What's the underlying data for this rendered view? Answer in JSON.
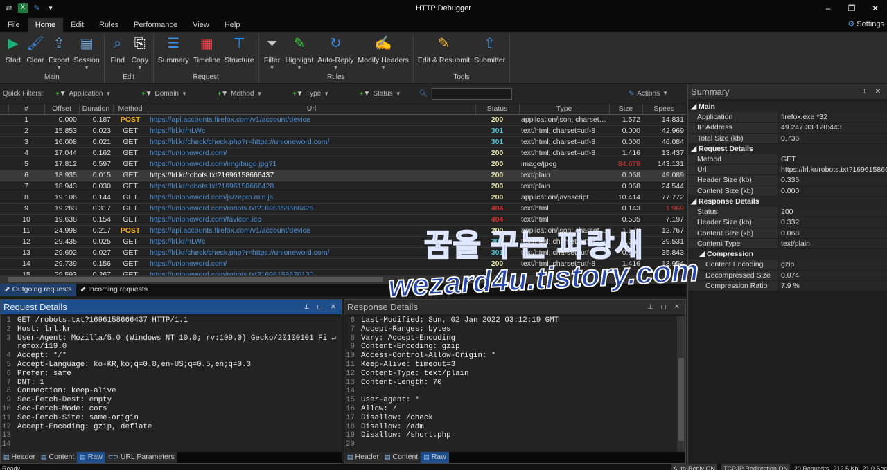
{
  "app": {
    "title": "HTTP Debugger",
    "settings": "Settings"
  },
  "menu_tabs": [
    "File",
    "Home",
    "Edit",
    "Rules",
    "Performance",
    "View",
    "Help"
  ],
  "ribbon": [
    {
      "group": "Main",
      "buttons": [
        {
          "label": "Start",
          "icon": "play-icon",
          "color": "#1db07a"
        },
        {
          "label": "Clear",
          "icon": "broom-icon",
          "color": "#3a8ee6"
        },
        {
          "label": "Export",
          "icon": "export-icon",
          "dropdown": true,
          "color": "#6fa8dc"
        },
        {
          "label": "Session",
          "icon": "session-icon",
          "dropdown": true,
          "color": "#6fa8dc"
        }
      ]
    },
    {
      "group": "Edit",
      "buttons": [
        {
          "label": "Find",
          "icon": "find-icon",
          "color": "#4a90d9"
        },
        {
          "label": "Copy",
          "icon": "copy-icon",
          "dropdown": true,
          "color": "#ffffff"
        }
      ]
    },
    {
      "group": "Request",
      "buttons": [
        {
          "label": "Summary",
          "icon": "summary-icon",
          "color": "#3a8ee6"
        },
        {
          "label": "Timeline",
          "icon": "timeline-icon",
          "color": "#e04040"
        },
        {
          "label": "Structure",
          "icon": "structure-icon",
          "color": "#1e90ff"
        }
      ]
    },
    {
      "group": "Rules",
      "buttons": [
        {
          "label": "Filter",
          "icon": "filter-icon",
          "dropdown": true,
          "color": "#cccccc"
        },
        {
          "label": "Highlight",
          "icon": "highlight-icon",
          "dropdown": true,
          "color": "#3c3"
        },
        {
          "label": "Auto-Reply",
          "icon": "auto-reply-icon",
          "dropdown": true,
          "color": "#3a8ee6"
        },
        {
          "label": "Modify Headers",
          "icon": "modify-headers-icon",
          "dropdown": true,
          "color": "#f0b020"
        }
      ]
    },
    {
      "group": "Tools",
      "buttons": [
        {
          "label": "Edit & Resubmit",
          "icon": "edit-resubmit-icon",
          "color": "#f0b020"
        },
        {
          "label": "Submitter",
          "icon": "submitter-icon",
          "color": "#3a8ee6"
        }
      ]
    }
  ],
  "quick_filters": {
    "label": "Quick Filters:",
    "filters": [
      "Application",
      "Domain",
      "Method",
      "Type",
      "Status"
    ],
    "search_value": "",
    "actions": "Actions"
  },
  "columns": [
    "#",
    "Offset",
    "Duration",
    "Method",
    "Url",
    "Status",
    "Type",
    "Size",
    "Speed"
  ],
  "rows": [
    [
      "1",
      "0.000",
      "0.187",
      "POST",
      "https://api.accounts.firefox.com/v1/account/device",
      "200",
      "application/json; charset=utf-8",
      "1.572",
      "14.831"
    ],
    [
      "2",
      "15.853",
      "0.023",
      "GET",
      "https://lrl.kr/nLWc",
      "301",
      "text/html; charset=utf-8",
      "0.000",
      "42.969"
    ],
    [
      "3",
      "16.008",
      "0.021",
      "GET",
      "https://lrl.kr/check/check.php?r=https://unioneword.com/",
      "301",
      "text/html; charset=utf-8",
      "0.000",
      "46.084"
    ],
    [
      "4",
      "17.044",
      "0.162",
      "GET",
      "https://unioneword.com/",
      "200",
      "text/html; charset=utf-8",
      "1.416",
      "13.437"
    ],
    [
      "5",
      "17.812",
      "0.597",
      "GET",
      "https://unioneword.com/img/bugo.jpg?1",
      "200",
      "image/jpeg",
      "84.679",
      "143.131"
    ],
    [
      "6",
      "18.935",
      "0.015",
      "GET",
      "https://lrl.kr/robots.txt?1696158666437",
      "200",
      "text/plain",
      "0.068",
      "49.089"
    ],
    [
      "7",
      "18.943",
      "0.030",
      "GET",
      "https://lrl.kr/robots.txt?1696158666428",
      "200",
      "text/plain",
      "0.068",
      "24.544"
    ],
    [
      "8",
      "19.106",
      "0.144",
      "GET",
      "https://unioneword.com/js/zepto.min.js",
      "200",
      "application/javascript",
      "10.414",
      "77.772"
    ],
    [
      "9",
      "19.263",
      "0.317",
      "GET",
      "https://unioneword.com/robots.txt?1696158666426",
      "404",
      "text/html",
      "0.143",
      "1.969"
    ],
    [
      "10",
      "19.638",
      "0.154",
      "GET",
      "https://unioneword.com/favicon.ico",
      "404",
      "text/html",
      "0.535",
      "7.197"
    ],
    [
      "11",
      "24.998",
      "0.217",
      "POST",
      "https://api.accounts.firefox.com/v1/account/device",
      "200",
      "application/json; charset=utf-8",
      "1.572",
      "12.767"
    ],
    [
      "12",
      "29.435",
      "0.025",
      "GET",
      "https://lrl.kr/nLWc",
      "301",
      "text/html; charset=utf-8",
      "0.000",
      "39.531"
    ],
    [
      "13",
      "29.602",
      "0.027",
      "GET",
      "https://lrl.kr/check/check.php?r=https://unioneword.com/",
      "301",
      "text/html; charset=utf-8",
      "0.000",
      "35.843"
    ],
    [
      "14",
      "29.739",
      "0.156",
      "GET",
      "https://unioneword.com/",
      "200",
      "text/html; charset=utf-8",
      "1.416",
      "13.954"
    ],
    [
      "15",
      "29.593",
      "0.267",
      "GET",
      "https://unioneword.com/robots.txt?1696158670130",
      "",
      "",
      "",
      ""
    ]
  ],
  "selected_row": 6,
  "highlight_red": {
    "size_row": 5,
    "speed_row": 9
  },
  "request_tabs": [
    "Outgoing requests",
    "Incoming requests"
  ],
  "request_details": {
    "title": "Request Details",
    "lines": [
      [
        "1",
        "GET /robots.txt?1696158666437 HTTP/1.1"
      ],
      [
        "2",
        "Host: lrl.kr"
      ],
      [
        "3",
        "User-Agent: Mozilla/5.0 (Windows NT 10.0; rv:109.0) Gecko/20100101 Fi ↵"
      ],
      [
        "",
        "refox/119.0"
      ],
      [
        "4",
        "Accept: */*"
      ],
      [
        "5",
        "Accept-Language: ko-KR,ko;q=0.8,en-US;q=0.5,en;q=0.3"
      ],
      [
        "6",
        "Prefer: safe"
      ],
      [
        "7",
        "DNT: 1"
      ],
      [
        "8",
        "Connection: keep-alive"
      ],
      [
        "9",
        "Sec-Fetch-Dest: empty"
      ],
      [
        "10",
        "Sec-Fetch-Mode: cors"
      ],
      [
        "11",
        "Sec-Fetch-Site: same-origin"
      ],
      [
        "12",
        "Accept-Encoding: gzip, deflate"
      ],
      [
        "13",
        ""
      ],
      [
        "14",
        ""
      ]
    ],
    "tabs": [
      "Header",
      "Content",
      "Raw",
      "URL Parameters"
    ],
    "active_tab": "Raw"
  },
  "response_details": {
    "title": "Response Details",
    "lines": [
      [
        "6",
        "Last-Modified: Sun, 02 Jan 2022 03:12:19 GMT"
      ],
      [
        "7",
        "Accept-Ranges: bytes"
      ],
      [
        "8",
        "Vary: Accept-Encoding"
      ],
      [
        "9",
        "Content-Encoding: gzip"
      ],
      [
        "10",
        "Access-Control-Allow-Origin: *"
      ],
      [
        "11",
        "Keep-Alive: timeout=3"
      ],
      [
        "12",
        "Content-Type: text/plain"
      ],
      [
        "13",
        "Content-Length: 70"
      ],
      [
        "14",
        ""
      ],
      [
        "15",
        "User-agent: *"
      ],
      [
        "16",
        "Allow: /"
      ],
      [
        "17",
        "Disallow: /check"
      ],
      [
        "18",
        "Disallow: /adm"
      ],
      [
        "19",
        "Disallow: /short.php"
      ],
      [
        "20",
        ""
      ]
    ],
    "tabs": [
      "Header",
      "Content",
      "Raw"
    ],
    "active_tab": "Raw"
  },
  "summary": {
    "title": "Summary",
    "sections": [
      {
        "name": "Main",
        "props": [
          [
            "Application",
            "firefox.exe *32"
          ],
          [
            "IP Address",
            "49.247.33.128:443"
          ],
          [
            "Total Size (kb)",
            "0.736"
          ]
        ]
      },
      {
        "name": "Request Details",
        "props": [
          [
            "Method",
            "GET"
          ],
          [
            "Url",
            "https://lrl.kr/robots.txt?1696158666437"
          ],
          [
            "Header Size (kb)",
            "0.336"
          ],
          [
            "Content Size (kb)",
            "0.000"
          ]
        ]
      },
      {
        "name": "Response Details",
        "props": [
          [
            "Status",
            "200"
          ],
          [
            "Header Size (kb)",
            "0.332"
          ],
          [
            "Content Size (kb)",
            "0.068"
          ],
          [
            "Content Type",
            "text/plain"
          ]
        ]
      },
      {
        "name": "Compression",
        "sub": true,
        "props": [
          [
            "Content Encoding",
            "gzip"
          ],
          [
            "Decompressed Size (kb)",
            "0.074"
          ],
          [
            "Compression Ratio",
            "7.9 %"
          ]
        ]
      }
    ]
  },
  "statusbar": {
    "left": "Ready",
    "items": [
      "Auto-Reply ON",
      "TCP/IP Redirection ON",
      "20 Requests",
      "212.5 Kb",
      "21.0 Sec"
    ]
  },
  "watermark": {
    "line1": "꿈을 꾸는 파랑새",
    "line2": "wezard4u.tistory.com"
  }
}
